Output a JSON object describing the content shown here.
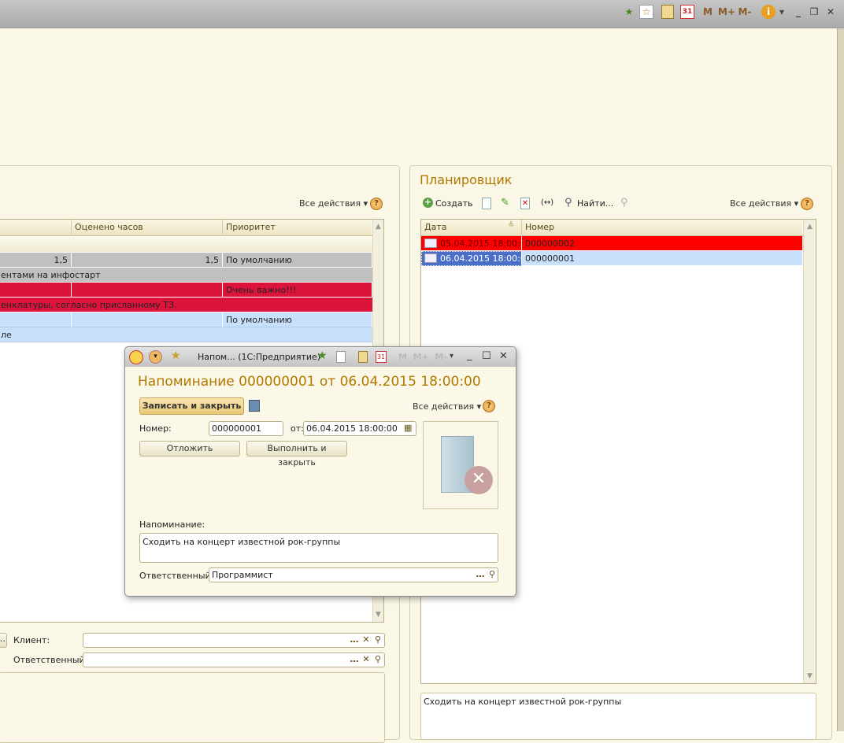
{
  "topbar": {
    "icons": [
      "add-favorite-icon",
      "favorites-icon",
      "calculator-icon",
      "calendar-icon",
      "memory-m-icon",
      "memory-plus-icon",
      "memory-minus-icon",
      "info-icon"
    ],
    "m": "M",
    "mplus": "M+",
    "mminus": "M-",
    "calendar": "31"
  },
  "left": {
    "all_actions": "Все действия",
    "columns": [
      "",
      "Оценено часов",
      "Приоритет"
    ],
    "rows": [
      {
        "c1": "1,5",
        "c2": "1,5",
        "c3": "По умолчанию",
        "desc": "ентами на инфостарт",
        "color": "#c0c0c0"
      },
      {
        "c1": "",
        "c2": "",
        "c3": "Очень важно!!!",
        "desc": "енклатуры, согласно присланному ТЗ.",
        "color": "#dc143c"
      },
      {
        "c1": "",
        "c2": "",
        "c3": "По умолчанию",
        "desc": "ле",
        "color": "#c8e0fa"
      }
    ],
    "client_label": "Клиент:",
    "client_value": "",
    "responsible_label": "Ответственный:",
    "responsible_value": ""
  },
  "planner": {
    "title": "Планировщик",
    "create": "Создать",
    "find": "Найти...",
    "all_actions": "Все действия",
    "columns": [
      "Дата",
      "Номер"
    ],
    "rows": [
      {
        "date": "05.04.2015 18:00:00",
        "number": "000000002",
        "color": "#ff0000"
      },
      {
        "date": "06.04.2015 18:00:00",
        "number": "000000001",
        "color": "#c8e0fa"
      }
    ],
    "details": "Сходить на концерт известной рок-группы"
  },
  "dialog": {
    "window_title": "Напом...  (1С:Предприятие)",
    "heading": "Напоминание 000000001 от 06.04.2015 18:00:00",
    "save_close": "Записать и закрыть",
    "all_actions": "Все действия",
    "number_label": "Номер:",
    "number_value": "000000001",
    "from_label": "от:",
    "date_value": "06.04.2015 18:00:00",
    "postpone": "Отложить",
    "complete_close": "Выполнить и закрыть",
    "reminder_label": "Напоминание:",
    "reminder_value": "Сходить на концерт известной рок-группы",
    "responsible_label": "Ответственный:",
    "responsible_value": "Программист",
    "logo": "1С"
  }
}
